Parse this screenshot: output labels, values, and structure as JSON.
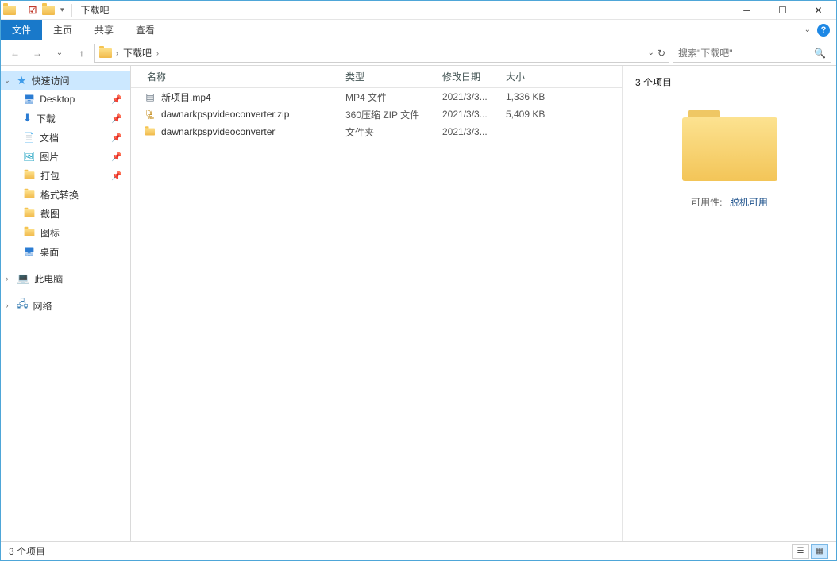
{
  "window": {
    "title": "下载吧"
  },
  "ribbon": {
    "file": "文件",
    "tabs": [
      "主页",
      "共享",
      "查看"
    ]
  },
  "breadcrumb": {
    "current": "下载吧"
  },
  "search": {
    "placeholder": "搜索\"下载吧\""
  },
  "sidebar": {
    "quick_access": "快速访问",
    "items": [
      {
        "label": "Desktop",
        "icon": "desk"
      },
      {
        "label": "下载",
        "icon": "dl"
      },
      {
        "label": "文档",
        "icon": "doc"
      },
      {
        "label": "图片",
        "icon": "img"
      },
      {
        "label": "打包",
        "icon": "folder"
      },
      {
        "label": "格式转换",
        "icon": "folder"
      },
      {
        "label": "截图",
        "icon": "folder"
      },
      {
        "label": "图标",
        "icon": "folder"
      },
      {
        "label": "桌面",
        "icon": "monitor"
      }
    ],
    "this_pc": "此电脑",
    "network": "网络"
  },
  "columns": {
    "name": "名称",
    "type": "类型",
    "date": "修改日期",
    "size": "大小"
  },
  "files": [
    {
      "name": "新项目.mp4",
      "type": "MP4 文件",
      "date": "2021/3/3...",
      "size": "1,336 KB",
      "icon": "mp4"
    },
    {
      "name": "dawnarkpspvideoconverter.zip",
      "type": "360压缩 ZIP 文件",
      "date": "2021/3/3...",
      "size": "5,409 KB",
      "icon": "zip"
    },
    {
      "name": "dawnarkpspvideoconverter",
      "type": "文件夹",
      "date": "2021/3/3...",
      "size": "",
      "icon": "folder"
    }
  ],
  "preview": {
    "count_label": "3 个项目",
    "availability_label": "可用性:",
    "availability_value": "脱机可用"
  },
  "status": {
    "text": "3 个项目"
  }
}
